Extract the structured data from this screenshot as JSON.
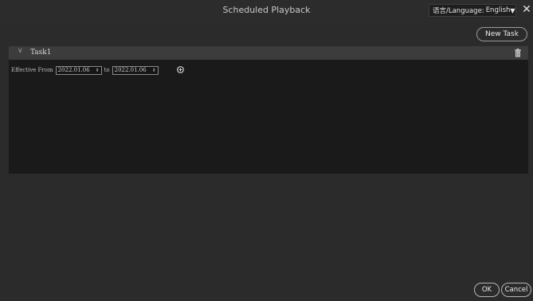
{
  "window": {
    "title": "Scheduled Playback",
    "language_label": "语言/Language:",
    "language_value": "English",
    "close_icon": "close-icon"
  },
  "toolbar": {
    "new_task_label": "New Task"
  },
  "task": {
    "name": "Task1",
    "effective_label": "Effective From",
    "from_date": "2022.01.06",
    "to_label": "to",
    "to_date": "2022.01.06"
  },
  "footer": {
    "ok_label": "OK",
    "cancel_label": "Cancel"
  },
  "colors": {
    "background": "#2b2b2b",
    "panel": "#1a1a1a",
    "header": "#3c3c3c"
  }
}
